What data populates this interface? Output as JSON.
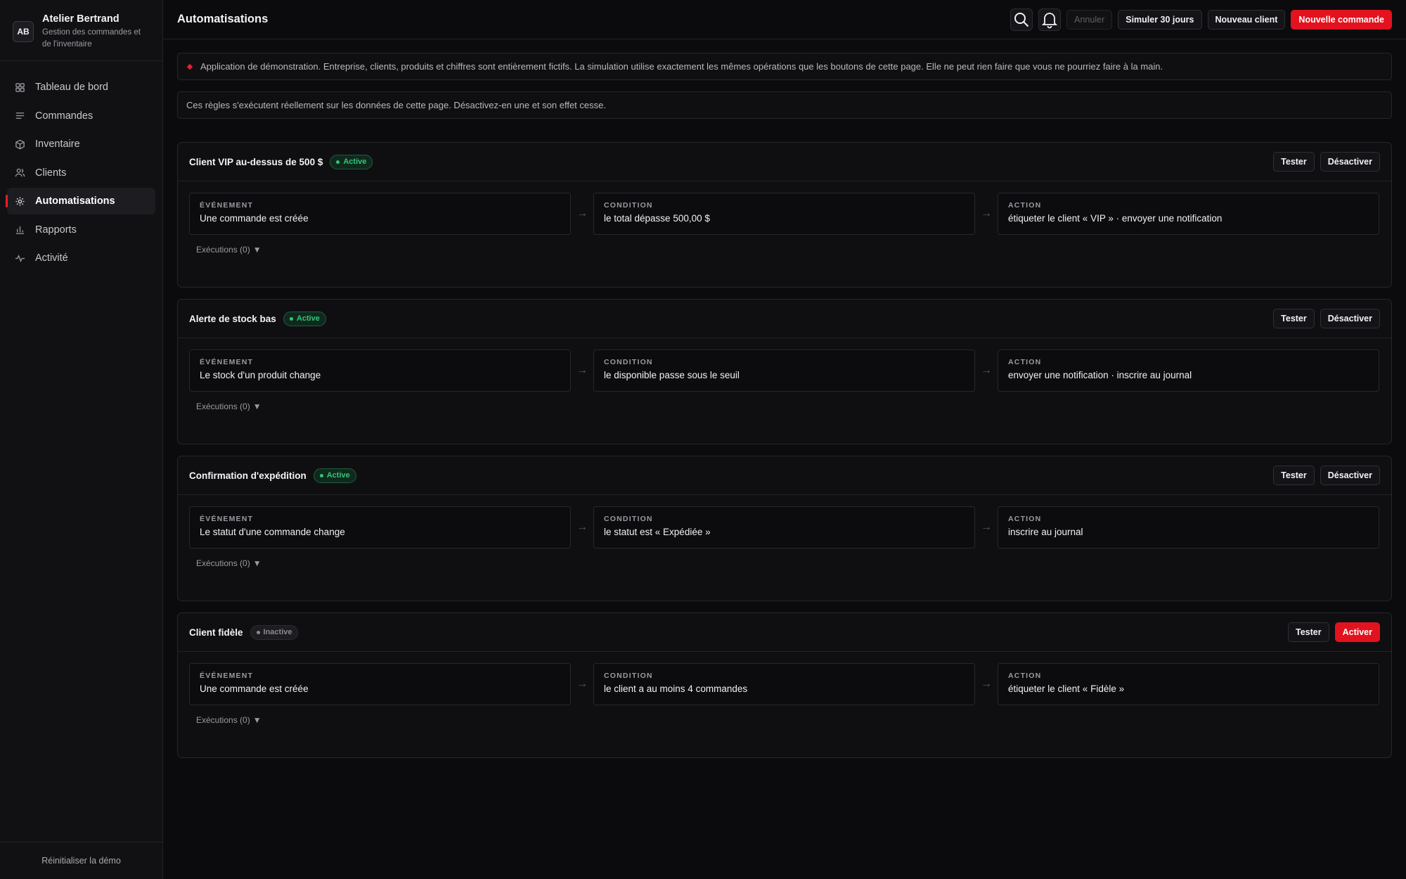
{
  "brand": {
    "initials": "AB",
    "name": "Atelier Bertrand",
    "subtitle": "Gestion des commandes et de l'inventaire"
  },
  "sidebar": {
    "items": [
      {
        "label": "Tableau de bord",
        "icon": "dashboard-icon"
      },
      {
        "label": "Commandes",
        "icon": "list-icon"
      },
      {
        "label": "Inventaire",
        "icon": "box-icon"
      },
      {
        "label": "Clients",
        "icon": "users-icon"
      },
      {
        "label": "Automatisations",
        "icon": "gear-icon",
        "active": true
      },
      {
        "label": "Rapports",
        "icon": "bar-chart-icon"
      },
      {
        "label": "Activité",
        "icon": "pulse-icon"
      }
    ],
    "footer": "Réinitialiser la démo"
  },
  "header": {
    "title": "Automatisations",
    "undo": "Annuler",
    "simulate": "Simuler 30 jours",
    "new_client": "Nouveau client",
    "new_order": "Nouvelle commande"
  },
  "notice": "Application de démonstration. Entreprise, clients, produits et chiffres sont entièrement fictifs. La simulation utilise exactement les mêmes opérations que les boutons de cette page. Elle ne peut rien faire que vous ne pourriez faire à la main.",
  "info": "Ces règles s'exécutent réellement sur les données de cette page. Désactivez-en une et son effet cesse.",
  "labels": {
    "event": "ÉVÉNEMENT",
    "condition": "CONDITION",
    "action": "ACTION",
    "test": "Tester",
    "arrow": "→"
  },
  "rules": [
    {
      "name": "Client VIP au-dessus de 500 $",
      "status": "Active",
      "toggle": "Désactiver",
      "event": "Une commande est créée",
      "condition": "le total dépasse 500,00 $",
      "action": "étiqueter le client « VIP » · envoyer une notification",
      "executions": "Exécutions (0)"
    },
    {
      "name": "Alerte de stock bas",
      "status": "Active",
      "toggle": "Désactiver",
      "event": "Le stock d'un produit change",
      "condition": "le disponible passe sous le seuil",
      "action": "envoyer une notification · inscrire au journal",
      "executions": "Exécutions (0)"
    },
    {
      "name": "Confirmation d'expédition",
      "status": "Active",
      "toggle": "Désactiver",
      "event": "Le statut d'une commande change",
      "condition": "le statut est « Expédiée »",
      "action": "inscrire au journal",
      "executions": "Exécutions (0)"
    },
    {
      "name": "Client fidèle",
      "status": "Inactive",
      "toggle": "Activer",
      "event": "Une commande est créée",
      "condition": "le client a au moins 4 commandes",
      "action": "étiqueter le client « Fidèle »",
      "executions": "Exécutions (0)"
    }
  ],
  "colors": {
    "accent": "#e3121f",
    "active_badge": "#36c47a",
    "background": "#0b0b0d"
  }
}
